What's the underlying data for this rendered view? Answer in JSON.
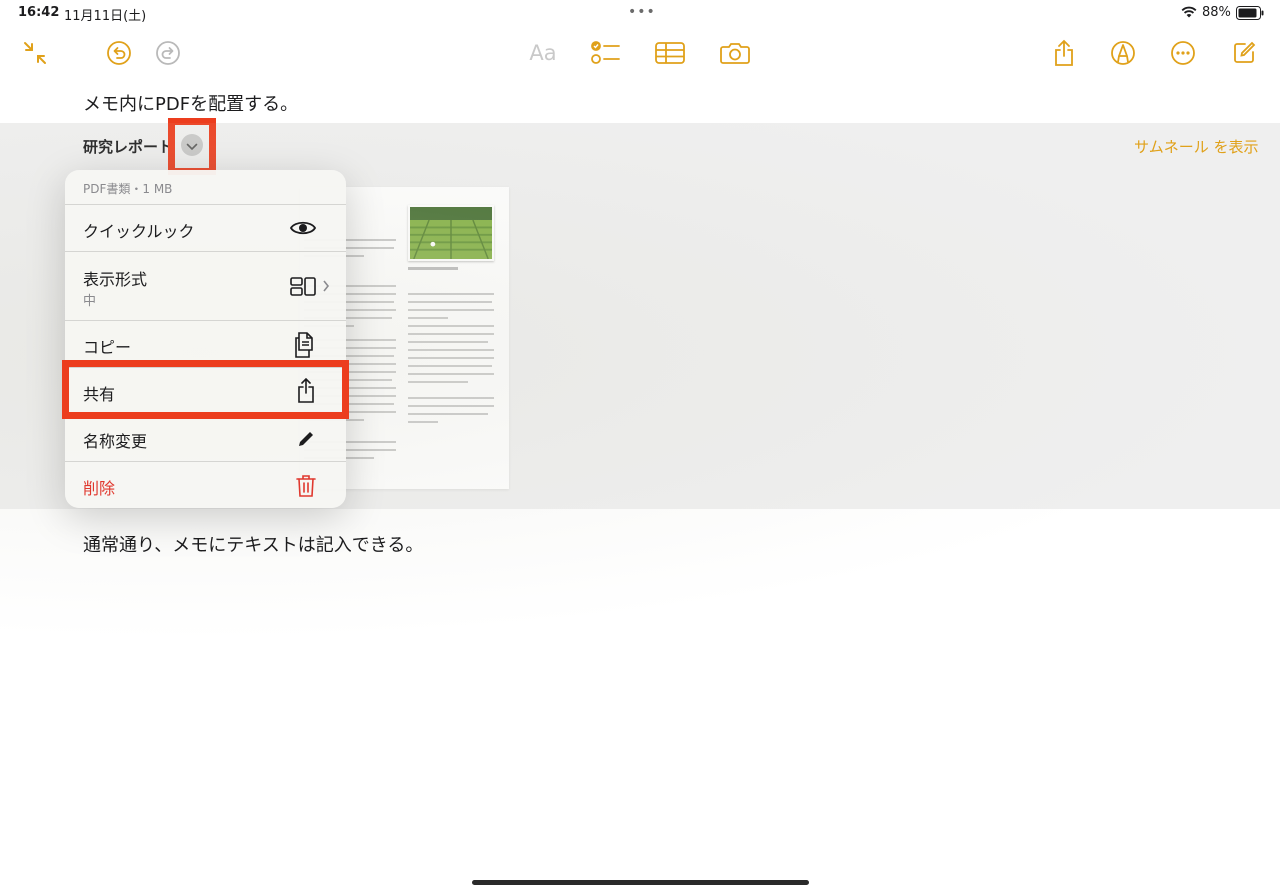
{
  "status_bar": {
    "time": "16:42",
    "date": "11月11日(土)",
    "multitask": "•••",
    "battery": "88%"
  },
  "toolbar": {
    "left": [
      "collapse-icon",
      "undo-icon",
      "redo-icon"
    ],
    "center": {
      "format_label": "Aa",
      "icons": [
        "checklist-icon",
        "table-icon",
        "camera-icon"
      ]
    },
    "right": [
      "share-icon",
      "markup-icon",
      "more-icon",
      "compose-icon"
    ]
  },
  "accent_color": "#e0a11a",
  "highlight_color": "#ec3d1e",
  "note": {
    "line1": "メモ内にPDFを配置する。",
    "line2": "通常通り、メモにテキストは記入できる。"
  },
  "attachment": {
    "title": "研究レポート",
    "show_thumbnails": "サムネール を表示"
  },
  "menu": {
    "header": "PDF書類・1 MB",
    "items": [
      {
        "label": "クイックルック",
        "icon": "eye-icon"
      },
      {
        "label": "表示形式",
        "sub": "中",
        "icon": "layout-icon"
      },
      {
        "label": "コピー",
        "icon": "copy-icon"
      },
      {
        "label": "共有",
        "icon": "share-icon"
      },
      {
        "label": "名称変更",
        "icon": "pencil-icon"
      },
      {
        "label": "削除",
        "icon": "trash-icon",
        "destructive": true
      }
    ]
  }
}
